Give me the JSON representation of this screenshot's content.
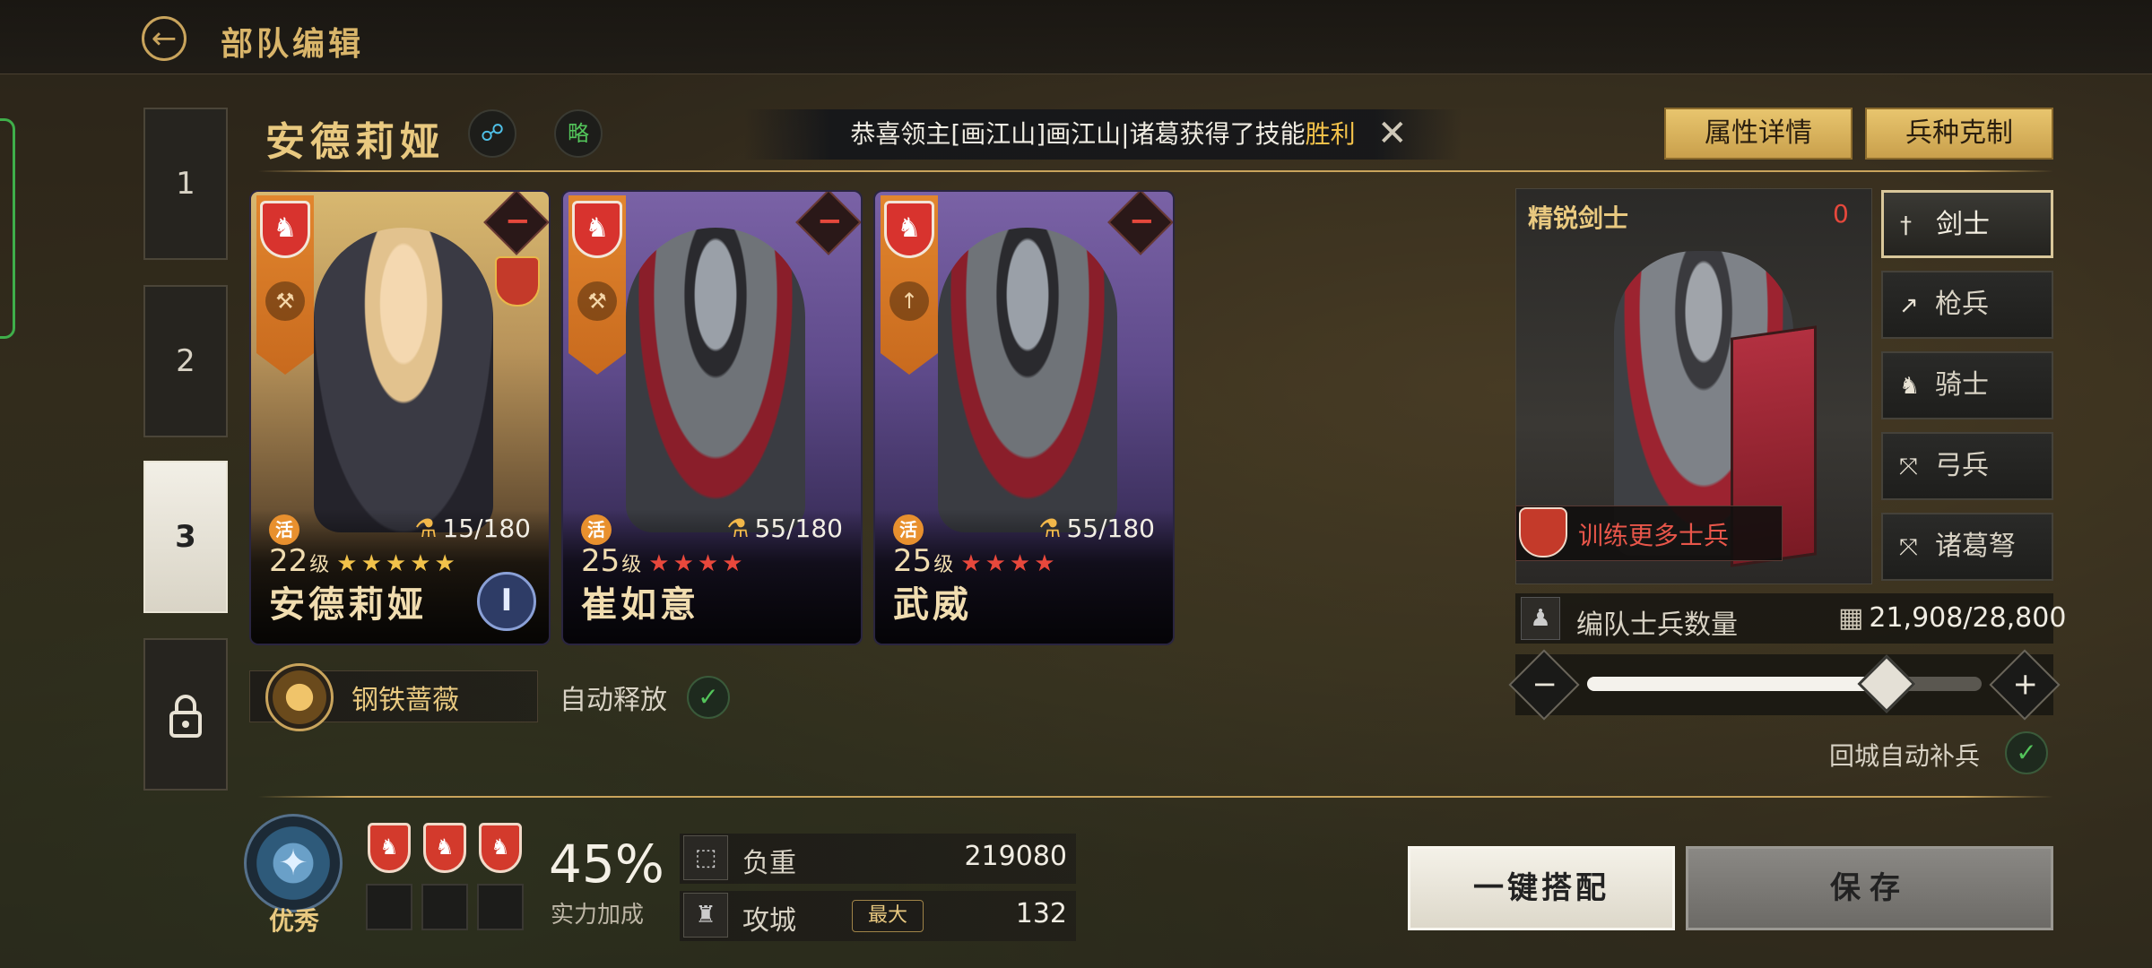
{
  "header": {
    "title": "部队编辑"
  },
  "squad_tabs": [
    {
      "label": "1"
    },
    {
      "label": "2"
    },
    {
      "label": "3",
      "active": true
    },
    {
      "label": "",
      "icon": "lock-icon"
    }
  ],
  "hero": {
    "name": "安德莉娅",
    "share_icon": "share-icon",
    "strategy_label": "略"
  },
  "notice": {
    "prefix": "恭喜领主[画江山]画江山|诸葛",
    "middle": "获得了技能",
    "highlight": "胜利"
  },
  "top_buttons": {
    "attributes": "属性详情",
    "counters": "兵种克制"
  },
  "cards": [
    {
      "name": "安德莉娅",
      "level": "22",
      "level_unit": "级",
      "stars": "★★★★★",
      "star_color": "gold",
      "active_label": "活",
      "troops": "15/180",
      "theme": "gold",
      "weapon_icon": "axe-icon"
    },
    {
      "name": "崔如意",
      "level": "25",
      "level_unit": "级",
      "stars": "★★★★",
      "star_color": "red",
      "active_label": "活",
      "troops": "55/180",
      "theme": "purple",
      "weapon_icon": "axe-icon"
    },
    {
      "name": "武威",
      "level": "25",
      "level_unit": "级",
      "stars": "★★★★",
      "star_color": "red",
      "active_label": "活",
      "troops": "55/180",
      "theme": "purple",
      "weapon_icon": "spear-icon"
    }
  ],
  "skill": {
    "name": "钢铁蔷薇",
    "auto_release": "自动释放"
  },
  "troop_panel": {
    "title": "精锐剑士",
    "count": "0",
    "train_more": "训练更多士兵"
  },
  "troop_types": [
    {
      "label": "剑士",
      "icon": "sword-icon",
      "active": true
    },
    {
      "label": "枪兵",
      "icon": "spear-icon"
    },
    {
      "label": "骑士",
      "icon": "horse-icon"
    },
    {
      "label": "弓兵",
      "icon": "bow-icon"
    },
    {
      "label": "诸葛弩",
      "icon": "crossbow-icon"
    }
  ],
  "formation": {
    "label": "编队士兵数量",
    "value": "21,908/28,800",
    "fill": 0.76,
    "auto_refill": "回城自动补兵"
  },
  "rating": {
    "label": "优秀",
    "power_pct": "45%",
    "power_label": "实力加成"
  },
  "stats": [
    {
      "label": "负重",
      "value": "219080",
      "icon": "load-icon"
    },
    {
      "label": "攻城",
      "value": "132",
      "tag": "最大",
      "icon": "siege-icon"
    }
  ],
  "actions": {
    "auto_match": "一键搭配",
    "save": "保存"
  },
  "colors": {
    "gold": "#e9c980",
    "red": "#e5483c",
    "green": "#53c45a"
  }
}
